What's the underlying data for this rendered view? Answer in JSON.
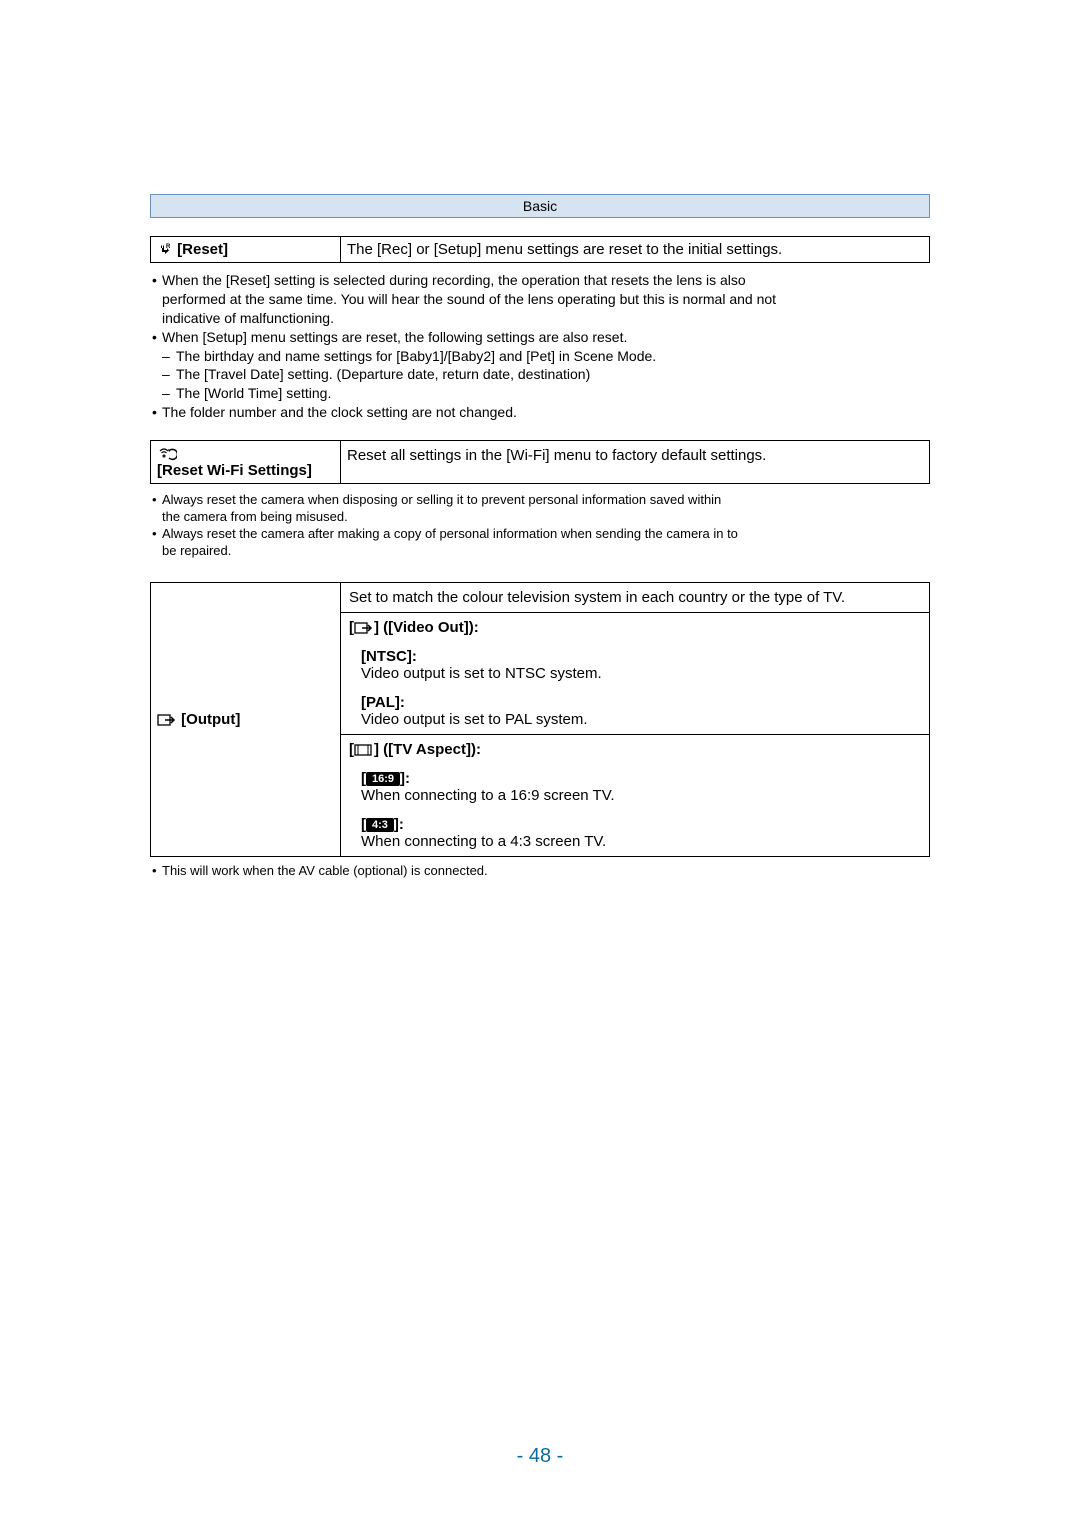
{
  "header": "Basic",
  "reset": {
    "label": "[Reset]",
    "desc": "The [Rec] or [Setup] menu settings are reset to the initial settings."
  },
  "reset_notes": {
    "n1a": "When the [Reset] setting is selected during recording, the operation that resets the lens is also",
    "n1b": "performed at the same time. You will hear the sound of the lens operating but this is normal and not",
    "n1c": "indicative of malfunctioning.",
    "n2": "When [Setup] menu settings are reset, the following settings are also reset.",
    "n2a": "The birthday and name settings for [Baby1]/[Baby2] and [Pet] in Scene Mode.",
    "n2b": "The [Travel Date] setting. (Departure date, return date, destination)",
    "n2c": "The [World Time] setting.",
    "n3": "The folder number and the clock setting are not changed."
  },
  "wifi": {
    "label": "[Reset Wi-Fi Settings]",
    "desc": "Reset all settings in the [Wi-Fi] menu to factory default settings."
  },
  "wifi_notes": {
    "n1a": "Always reset the camera when disposing or selling it to prevent personal information saved within",
    "n1b": "the camera from being misused.",
    "n2a": "Always reset the camera after making a copy of personal information when sending the camera in to",
    "n2b": "be repaired."
  },
  "output": {
    "label": "[Output]",
    "desc": "Set to match the colour television system in each country or the type of TV.",
    "video_out_head": "] ([Video Out]):",
    "ntsc_label": "[NTSC]:",
    "ntsc_desc": "Video output is set to NTSC system.",
    "pal_label": "[PAL]:",
    "pal_desc": "Video output is set to PAL system.",
    "tv_aspect_head": "] ([TV Aspect]):",
    "r169_label": "16:9",
    "r169_suffix": "]:",
    "r169_desc": "When connecting to a 16:9 screen TV.",
    "r43_label": "4:3",
    "r43_suffix": "]:",
    "r43_desc": "When connecting to a 4:3 screen TV."
  },
  "output_note": "This will work when the AV cable (optional) is connected.",
  "page_number": "- 48 -"
}
